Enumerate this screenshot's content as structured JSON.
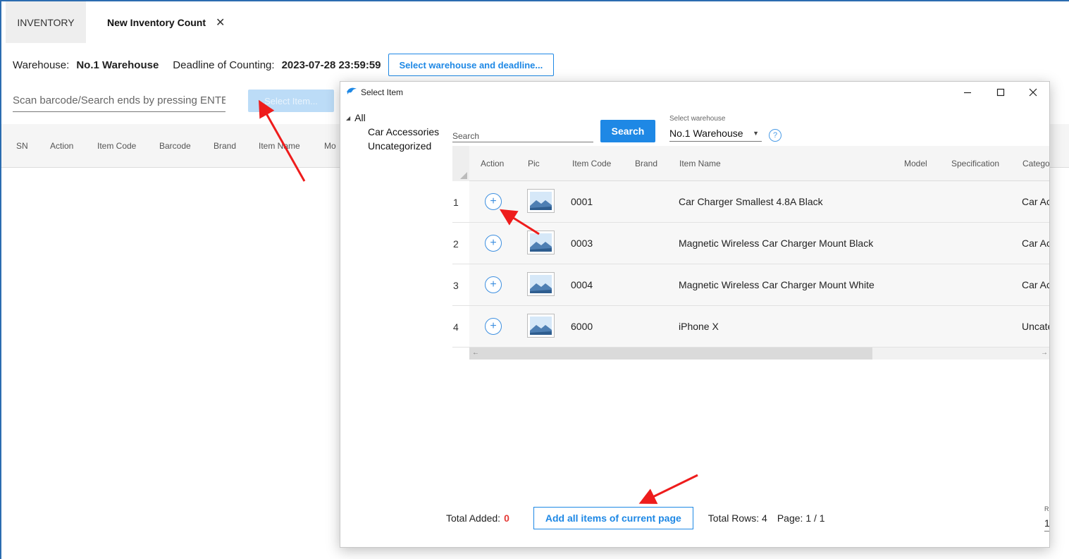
{
  "tabs": {
    "inventory": "INVENTORY",
    "new_count": "New Inventory Count",
    "close_glyph": "✕"
  },
  "warehouse_row": {
    "warehouse_label": "Warehouse:",
    "warehouse_value": "No.1  Warehouse",
    "deadline_label": "Deadline of Counting:",
    "deadline_value": "2023-07-28 23:59:59",
    "select_button": "Select warehouse and deadline..."
  },
  "scan": {
    "placeholder": "Scan barcode/Search ends by pressing ENTER",
    "select_item_button": "Select Item..."
  },
  "main_table": {
    "columns": [
      "SN",
      "Action",
      "Item Code",
      "Barcode",
      "Brand",
      "Item Name",
      "Mo"
    ]
  },
  "dialog": {
    "title": "Select Item",
    "minimize_glyph": "—",
    "maximize_glyph": "☐",
    "close_glyph": "✕",
    "tree": {
      "root": "All",
      "children": [
        "Car Accessories",
        "Uncategorized"
      ]
    },
    "search": {
      "placeholder": "Search",
      "button": "Search",
      "warehouse_label": "Select warehouse",
      "warehouse_value": "No.1  Warehouse",
      "help_glyph": "?"
    },
    "grid": {
      "columns": [
        "Action",
        "Pic",
        "Item Code",
        "Brand",
        "Item Name",
        "Model",
        "Specification",
        "Catego"
      ],
      "rows": [
        {
          "n": "1",
          "code": "0001",
          "name": "Car Charger  Smallest 4.8A Black",
          "category": "Car Ac"
        },
        {
          "n": "2",
          "code": "0003",
          "name": "Magnetic Wireless Car Charger Mount Black",
          "category": "Car Ac"
        },
        {
          "n": "3",
          "code": "0004",
          "name": "Magnetic Wireless Car Charger Mount White",
          "category": "Car Ac"
        },
        {
          "n": "4",
          "code": "6000",
          "name": "iPhone X",
          "category": "Uncate"
        }
      ]
    },
    "footer": {
      "total_added_label": "Total Added:",
      "total_added_value": "0",
      "add_all_button": "Add all items of current page",
      "total_rows": "Total Rows: 4",
      "page": "Page: 1 / 1",
      "rows_per_page_label": "R",
      "rows_per_page_value": "1"
    }
  },
  "colors": {
    "accent": "#1e88e5",
    "disabled_button": "#bcdcf7",
    "total_added": "#e53935",
    "annotation_arrow": "#ee1c1c"
  }
}
